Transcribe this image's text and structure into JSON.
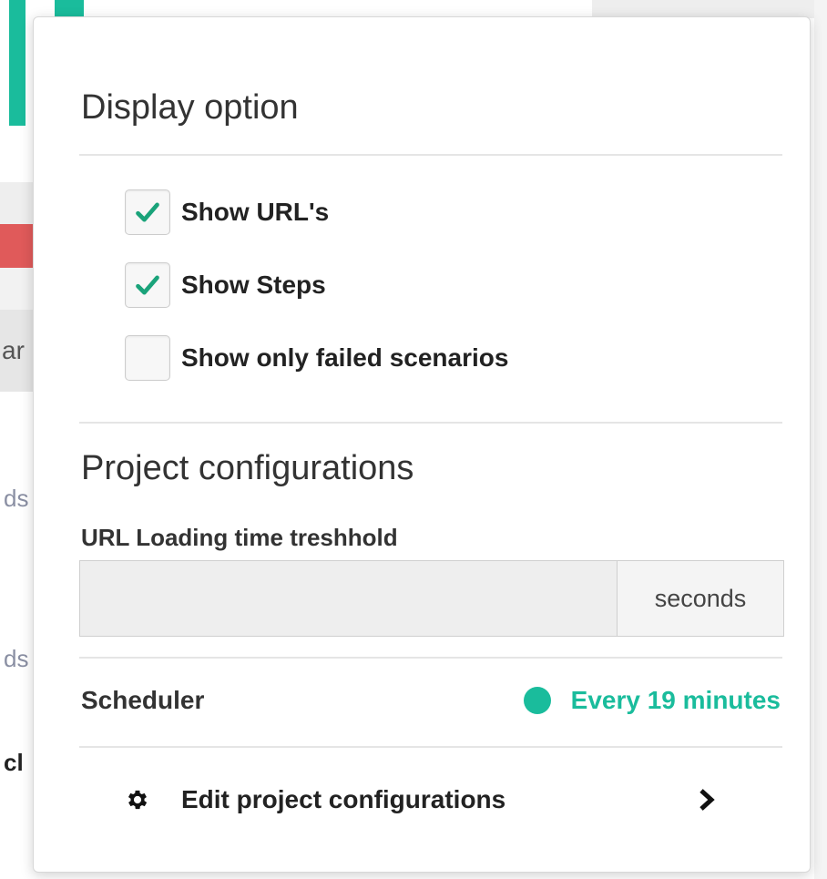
{
  "display_option": {
    "title": "Display option",
    "checkboxes": [
      {
        "label": "Show URL's",
        "checked": true
      },
      {
        "label": "Show Steps",
        "checked": true
      },
      {
        "label": "Show only failed scenarios",
        "checked": false
      }
    ]
  },
  "project_configurations": {
    "title": "Project configurations",
    "loading_threshold": {
      "label": "URL Loading time treshhold",
      "value": "",
      "unit": "seconds"
    },
    "scheduler": {
      "label": "Scheduler",
      "status": "Every 19 minutes",
      "status_color": "#1abc9c"
    },
    "edit_link": {
      "label": "Edit project configurations",
      "icon": "gear-icon",
      "chevron": "chevron-right-icon"
    }
  },
  "background": {
    "fragments": [
      "ar",
      "ds",
      "ds",
      "cl"
    ],
    "accent_color": "#1abc9c",
    "error_color": "#e05a5a"
  }
}
